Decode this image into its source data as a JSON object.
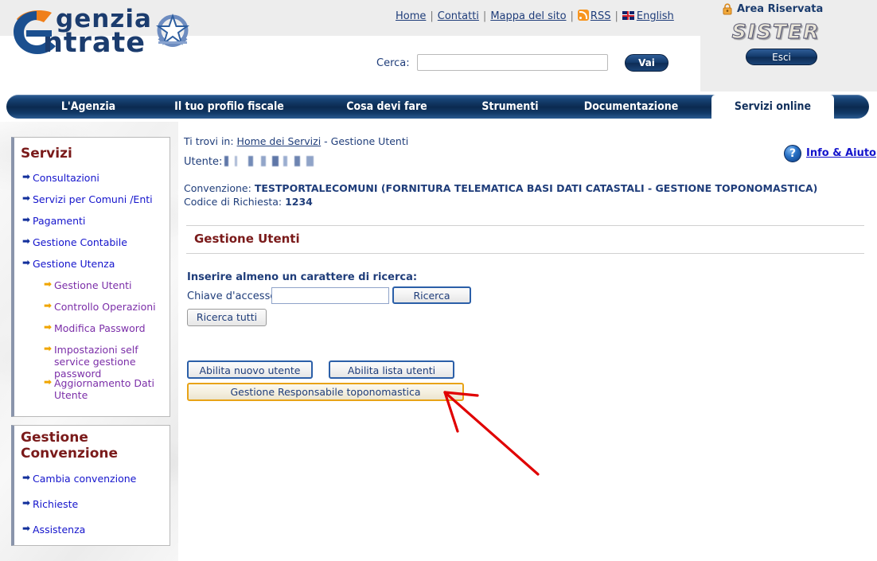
{
  "header": {
    "logo_line1": "genzia",
    "logo_line2": "ntrate",
    "logo_alt": "agenzia-entrate-logo",
    "emblem_alt": "repubblica-italiana-emblem",
    "toplinks": [
      {
        "label": "Home",
        "name": "home-link"
      },
      {
        "label": "Contatti",
        "name": "contatti-link"
      },
      {
        "label": "Mappa del sito",
        "name": "mappa-del-sito-link"
      },
      {
        "label": "RSS",
        "name": "rss-link"
      },
      {
        "label": "English",
        "name": "english-link"
      }
    ],
    "search": {
      "label": "Cerca:",
      "value": "",
      "placeholder": "",
      "button_label": "Vai"
    },
    "area_riservata": "Area Riservata",
    "sister_logo": "SISTER",
    "logout_label": "Esci"
  },
  "nav": {
    "items": [
      {
        "label": "L'Agenzia",
        "active": false
      },
      {
        "label": "Il tuo profilo fiscale",
        "active": false
      },
      {
        "label": "Cosa devi fare",
        "active": false
      },
      {
        "label": "Strumenti",
        "active": false
      },
      {
        "label": "Documentazione",
        "active": false
      },
      {
        "label": "Servizi online",
        "active": true
      }
    ]
  },
  "sidebar": {
    "box1": {
      "title": "Servizi",
      "items": [
        {
          "label": "Consultazioni",
          "sub": false
        },
        {
          "label": "Servizi per Comuni /Enti",
          "sub": false
        },
        {
          "label": "Pagamenti",
          "sub": false
        },
        {
          "label": "Gestione Contabile",
          "sub": false
        },
        {
          "label": "Gestione Utenza",
          "sub": false
        },
        {
          "label": "Gestione Utenti",
          "sub": true
        },
        {
          "label": "Controllo Operazioni",
          "sub": true
        },
        {
          "label": "Modifica Password",
          "sub": true
        },
        {
          "label": "Impostazioni self service gestione password",
          "sub": true
        },
        {
          "label": "Aggiornamento Dati Utente",
          "sub": true
        }
      ]
    },
    "box2": {
      "title_line1": "Gestione",
      "title_line2": "Convenzione",
      "items": [
        {
          "label": "Cambia convenzione",
          "sub": false
        },
        {
          "label": "Richieste",
          "sub": false
        },
        {
          "label": "Assistenza",
          "sub": false
        }
      ]
    }
  },
  "content": {
    "breadcrumb_prefix": "Ti trovi in:",
    "breadcrumb_link": "Home dei Servizi",
    "breadcrumb_sep": "-",
    "breadcrumb_current": "Gestione Utenti",
    "utente_label": "Utente:",
    "utente_value": "",
    "convenzione_label": "Convenzione:",
    "convenzione_value": "TESTPORTALECOMUNI (FORNITURA TELEMATICA BASI DATI CATASTALI - GESTIONE TOPONOMASTICA)",
    "codice_label": "Codice di Richiesta:",
    "codice_value": "1234",
    "info_aiuto": "Info & Aiuto",
    "help_icon_glyph": "?",
    "page_title": "Gestione Utenti",
    "instruction": "Inserire almeno un carattere di ricerca:",
    "chiave_label": "Chiave d'accesso:",
    "chiave_value": "",
    "chiave_placeholder": "",
    "buttons": {
      "ricerca": "Ricerca",
      "ricerca_tutti": "Ricerca tutti",
      "abilita_nuovo_utente": "Abilita nuovo utente",
      "abilita_lista_utenti": "Abilita lista utenti",
      "gestione_responsabile": "Gestione Responsabile toponomastica"
    }
  },
  "annotation": {
    "arrow_color": "#e00000",
    "arrow_target": "gestione-responsabile-toponomastica-button"
  },
  "colors": {
    "nav_bar": "#0b2a50",
    "heading_red": "#7a1a1a",
    "link_blue": "#1414cc",
    "visited_purple": "#7b2ea8",
    "text_blue": "#1f3d7a",
    "accent_orange": "#f0a500",
    "highlight_border": "#e8a317",
    "header_gray": "#ededed"
  }
}
